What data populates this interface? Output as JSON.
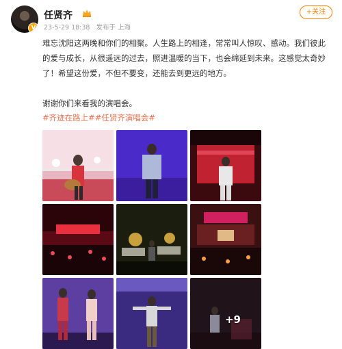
{
  "post": {
    "username": "任贤齐",
    "timestamp": "23-5-29 18:38",
    "source": "发布于 上海",
    "follow_label": "+关注",
    "paragraph1": "难忘沈阳这两晚和你们的相聚。人生路上的相逢，常常叫人惊叹、感动。我们彼此的爱与成长，从很遥远的过去，照进温暖的当下，也会绵延到未来。这感觉太奇妙了！希望这份爱，不但不要变，还能去到更远的地方。",
    "paragraph2": "谢谢你们来看我的演唱会。",
    "hashtags": [
      "#齐迹在路上#",
      "#任贤齐演唱会#"
    ],
    "more_photos": "+9",
    "photos": [
      {
        "name": "photo-guitar-stage"
      },
      {
        "name": "photo-purple-stage"
      },
      {
        "name": "photo-red-stage"
      },
      {
        "name": "photo-red-crowd"
      },
      {
        "name": "photo-thanks-screen"
      },
      {
        "name": "photo-crowd-lights"
      },
      {
        "name": "photo-duet-singers"
      },
      {
        "name": "photo-arms-open"
      },
      {
        "name": "photo-more"
      }
    ]
  },
  "colors": {
    "hashtag": "#eb7350",
    "follow": "#ff8200",
    "meta": "#9a9a9a"
  }
}
